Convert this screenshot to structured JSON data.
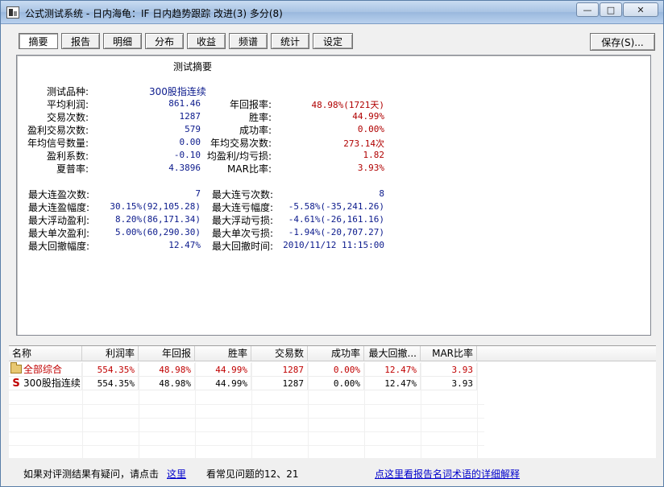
{
  "window": {
    "title": "公式测试系统 - 日内海龟：IF 日内趋势跟踪 改进(3) 多分(8)",
    "minimize": "—",
    "maximize": "□",
    "close": "✕"
  },
  "tabs": [
    {
      "label": "摘要",
      "active": true
    },
    {
      "label": "报告",
      "active": false
    },
    {
      "label": "明细",
      "active": false
    },
    {
      "label": "分布",
      "active": false
    },
    {
      "label": "收益",
      "active": false
    },
    {
      "label": "频谱",
      "active": false
    },
    {
      "label": "统计",
      "active": false
    },
    {
      "label": "设定",
      "active": false
    }
  ],
  "save_button": "保存(S)...",
  "summary": {
    "title": "测试摘要",
    "product_label": "测试品种:",
    "product_value": "300股指连续",
    "stats_left": [
      {
        "label": "平均利润:",
        "value": "861.46"
      },
      {
        "label": "交易次数:",
        "value": "1287"
      },
      {
        "label": "盈利交易次数:",
        "value": "579"
      },
      {
        "label": "年均信号数量:",
        "value": "0.00"
      },
      {
        "label": "盈利系数:",
        "value": "-0.10"
      },
      {
        "label": "夏普率:",
        "value": "4.3896"
      }
    ],
    "stats_right": [
      {
        "label": "年回报率:",
        "value": "48.98%(1721天)"
      },
      {
        "label": "胜率:",
        "value": "44.99%"
      },
      {
        "label": "成功率:",
        "value": "0.00%"
      },
      {
        "label": "年均交易次数:",
        "value": "273.14次"
      },
      {
        "label": "均盈利/均亏损:",
        "value": "1.82"
      },
      {
        "label": "MAR比率:",
        "value": "3.93%"
      }
    ],
    "extremes_left": [
      {
        "label": "最大连盈次数:",
        "value": "7"
      },
      {
        "label": "最大连盈幅度:",
        "value": "30.15%(92,105.28)"
      },
      {
        "label": "最大浮动盈利:",
        "value": "8.20%(86,171.34)"
      },
      {
        "label": "最大单次盈利:",
        "value": "5.00%(60,290.30)"
      },
      {
        "label": "最大回撤幅度:",
        "value": "12.47%"
      }
    ],
    "extremes_right": [
      {
        "label": "最大连亏次数:",
        "value": "8"
      },
      {
        "label": "最大连亏幅度:",
        "value": "-5.58%(-35,241.26)"
      },
      {
        "label": "最大浮动亏损:",
        "value": "-4.61%(-26,161.16)"
      },
      {
        "label": "最大单次亏损:",
        "value": "-1.94%(-20,707.27)"
      },
      {
        "label": "最大回撤时间:",
        "value": "2010/11/12 11:15:00"
      }
    ]
  },
  "table": {
    "columns": [
      "名称",
      "利润率",
      "年回报",
      "胜率",
      "交易数",
      "成功率",
      "最大回撤...",
      "MAR比率"
    ],
    "rows": [
      {
        "icon": "folder-icon",
        "name": "全部综合",
        "values": [
          "554.35%",
          "48.98%",
          "44.99%",
          "1287",
          "0.00%",
          "12.47%",
          "3.93"
        ],
        "color": "#c00000"
      },
      {
        "icon": "s-icon",
        "name": "300股指连续",
        "values": [
          "554.35%",
          "48.98%",
          "44.99%",
          "1287",
          "0.00%",
          "12.47%",
          "3.93"
        ],
        "color": "#000000"
      }
    ]
  },
  "status": {
    "question_text": "如果对评测结果有疑问，请点击",
    "here_link": "这里",
    "see_text": "看常见问题的12、21",
    "glossary_link": "点这里看报告名词术语的详细解释"
  },
  "colors": {
    "value_blue": "#0b1a8c",
    "value_red": "#b00000",
    "link_blue": "#0000cc"
  }
}
